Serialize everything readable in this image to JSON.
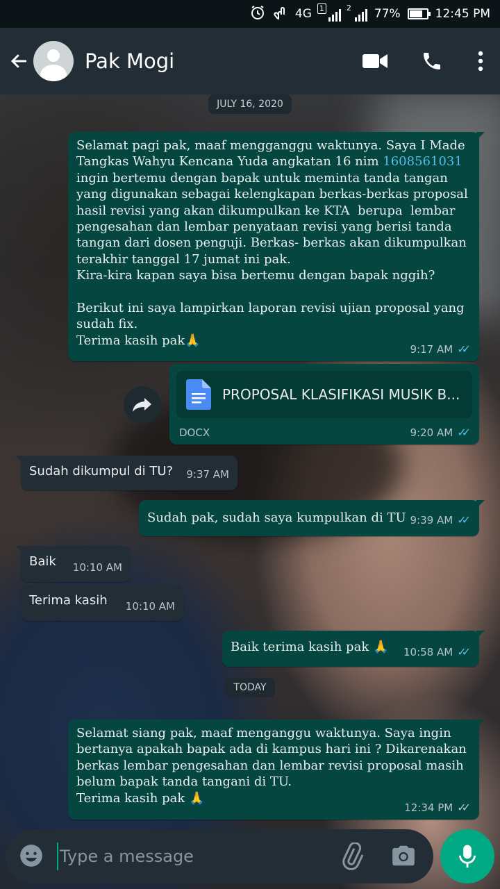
{
  "status": {
    "network": "4G",
    "sim1": "1",
    "sim2": "2",
    "battery": "77%",
    "battery_level": 0.77,
    "time": "12:45 PM"
  },
  "header": {
    "contact_name": "Pak Mogi"
  },
  "chips": {
    "date1": "JULY 16, 2020",
    "date2": "TODAY"
  },
  "messages": {
    "m1_text": "Selamat pagi pak, maaf mengganggu waktunya. Saya I Made Tangkas Wahyu Kencana Yuda angkatan 16 nim ",
    "m1_link": "1608561031",
    "m1_text2": "\ningin bertemu dengan bapak untuk meminta tanda tangan yang digunakan sebagai kelengkapan berkas-berkas proposal hasil revisi yang akan dikumpulkan ke KTA  berupa  lembar pengesahan dan lembar penyataan revisi yang berisi tanda tangan dari dosen penguji. Berkas- berkas akan dikumpulkan terakhir tanggal 17 jumat ini pak.\nKira-kira kapan saya bisa bertemu dengan bapak nggih?\n\nBerikut ini saya lampirkan laporan revisi ujian proposal yang sudah fix.\nTerima kasih pak🙏",
    "m1_time": "9:17 AM",
    "doc_title": "PROPOSAL KLASIFIKASI MUSIK B...",
    "doc_type": "DOCX",
    "doc_time": "9:20 AM",
    "m2_text": "Sudah dikumpul di TU?",
    "m2_time": "9:37 AM",
    "m3_text": "Sudah pak, sudah saya kumpulkan di TU",
    "m3_time": "9:39 AM",
    "m4_text": "Baik",
    "m4_time": "10:10 AM",
    "m5_text": "Terima kasih",
    "m5_time": "10:10 AM",
    "m6_text": "Baik terima kasih pak 🙏",
    "m6_time": "10:58 AM",
    "m7_text": "Selamat siang pak, maaf menganggu waktunya. Saya ingin bertanya apakah bapak ada di kampus hari ini ? Dikarenakan berkas lembar pengesahan dan lembar revisi proposal masih belum bapak tanda tangani di TU.\nTerima kasih pak 🙏",
    "m7_time": "12:34 PM"
  },
  "input": {
    "placeholder": "Type a message"
  },
  "icons": {
    "back": "arrow-left-icon",
    "video": "video-call-icon",
    "call": "phone-icon",
    "menu": "more-vert-icon",
    "emoji": "emoji-icon",
    "attach": "paperclip-icon",
    "camera": "camera-icon",
    "mic": "microphone-icon",
    "forward": "forward-icon",
    "doc": "document-icon"
  },
  "colors": {
    "outgoing": "#054740",
    "incoming": "#232d36",
    "read_ticks": "#53bdeb",
    "accent": "#00a884"
  }
}
